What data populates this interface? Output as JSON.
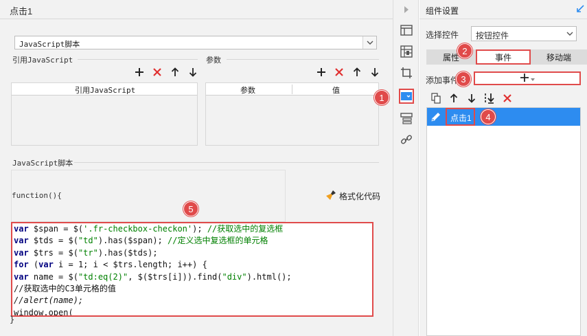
{
  "dialog": {
    "title": "点击1"
  },
  "script_type": {
    "selected": "JavaScript脚本"
  },
  "js_refs": {
    "label": "引用JavaScript",
    "column": "引用JavaScript",
    "tools": [
      "add-icon",
      "delete-icon",
      "move-up-icon",
      "move-down-icon"
    ]
  },
  "params": {
    "label": "参数",
    "columns": [
      "参数",
      "值"
    ],
    "tools": [
      "add-icon",
      "delete-icon",
      "move-up-icon",
      "move-down-icon"
    ]
  },
  "script": {
    "label": "JavaScript脚本",
    "function_header": "function(){",
    "format_button": "格式化代码",
    "closing_brace": "}",
    "lines": [
      "var $span = $('.fr-checkbox-checkon'); //获取选中的复选框",
      "var $tds = $(\"td\").has($span); //定义选中复选框的单元格",
      "var $trs = $(\"tr\").has($tds);",
      "for (var i = 1; i < $trs.length; i++) {",
      "var name = $(\"td:eq(2)\", $($trs[i])).find(\"div\").html();",
      "//获取选中的C3单元格的值",
      "//alert(name);",
      "window.open("
    ]
  },
  "side_toolbar": {
    "icons": [
      "form-layout-icon",
      "report-block-icon",
      "crop-icon",
      "control-settings-icon",
      "component-list-icon",
      "link-icon"
    ],
    "active": "control-settings-icon",
    "collapse_icon": "arrow-right-icon"
  },
  "settings": {
    "title": "组件设置",
    "select_label": "选择控件",
    "select_value": "按钮控件",
    "tabs": [
      "属性",
      "事件",
      "移动端"
    ],
    "active_tab": "事件",
    "add_event_label": "添加事件",
    "add_event_button": "+",
    "event_tools": [
      "copy-icon",
      "move-up-icon",
      "move-down-icon",
      "move-bottom-icon",
      "delete-icon"
    ],
    "events": [
      "点击1"
    ]
  },
  "badges": [
    "1",
    "2",
    "3",
    "4",
    "5"
  ],
  "colors": {
    "accent": "#2d8cf0",
    "highlight": "#e04a4a",
    "delete": "#e03030"
  }
}
